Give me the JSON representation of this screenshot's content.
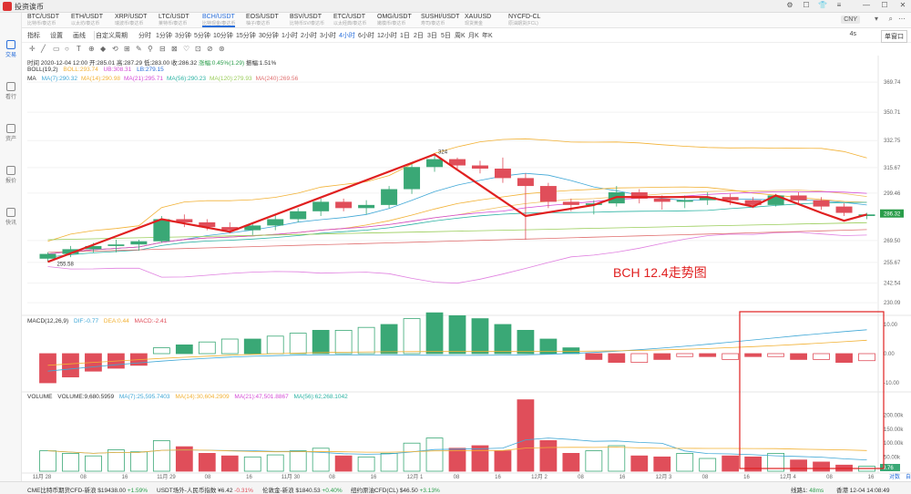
{
  "app": {
    "title": "投资诶币"
  },
  "nav": [
    {
      "label": "交易",
      "icon": "chart-icon",
      "active": true
    },
    {
      "label": "看行",
      "icon": "list-icon"
    },
    {
      "label": "资产",
      "icon": "wallet-icon"
    },
    {
      "label": "报价",
      "icon": "quote-icon"
    },
    {
      "label": "快讯",
      "icon": "news-icon"
    }
  ],
  "tabs": [
    {
      "symbol": "BTC/USDT",
      "sub": "比特币/泰达币"
    },
    {
      "symbol": "ETH/USDT",
      "sub": "以太坊/泰达币"
    },
    {
      "symbol": "XRP/USDT",
      "sub": "瑞波币/泰达币"
    },
    {
      "symbol": "LTC/USDT",
      "sub": "莱特币/泰达币"
    },
    {
      "symbol": "BCH/USDT",
      "sub": "比特现金/泰达币",
      "active": true
    },
    {
      "symbol": "EOS/USDT",
      "sub": "柚子/泰达币"
    },
    {
      "symbol": "BSV/USDT",
      "sub": "比特币SV/泰达币"
    },
    {
      "symbol": "ETC/USDT",
      "sub": "以太经典/泰达币"
    },
    {
      "symbol": "OMG/USDT",
      "sub": "嫩模币/泰达币"
    },
    {
      "symbol": "SUSHI/USDT",
      "sub": "寿司/泰达币"
    },
    {
      "symbol": "XAUUSD",
      "sub": "现货黄金"
    },
    {
      "symbol": "NYCFD-CL",
      "sub": "原油期货(FCL)"
    }
  ],
  "account": "CNY",
  "toolbar": {
    "items": [
      "指标",
      "设置",
      "画线",
      "自定义周期",
      "分时",
      "1分钟",
      "3分钟",
      "5分钟",
      "10分钟",
      "15分钟",
      "30分钟",
      "1小时",
      "2小时",
      "3小时",
      "4小时",
      "6小时",
      "12小时",
      "1日",
      "2日",
      "3日",
      "5日",
      "周K",
      "月K",
      "年K"
    ],
    "active": "4小时",
    "right_label": "4s",
    "single": "单窗口"
  },
  "ohlc": {
    "time": "时间 2020-12-04 12:00",
    "open": "开:285.01",
    "high": "高:287.29",
    "low": "低:283.00",
    "close": "收:286.32",
    "change": "涨幅:0.45%(1.29)",
    "amp": "振幅:1.51%"
  },
  "boll": {
    "label": "BOLL(19,2)",
    "boll": "BOLL:293.74",
    "ub": "UB:308.31",
    "lb": "LB:279.15"
  },
  "ma": {
    "label": "MA",
    "items": [
      {
        "text": "MA(7):290.32",
        "color": "#3fa7d6"
      },
      {
        "text": "MA(14):290.98",
        "color": "#f2b134"
      },
      {
        "text": "MA(21):295.71",
        "color": "#d44bd6"
      },
      {
        "text": "MA(56):290.23",
        "color": "#2bb3a3"
      },
      {
        "text": "MA(120):279.93",
        "color": "#9acd5a"
      },
      {
        "text": "MA(240):269.56",
        "color": "#e07070"
      }
    ]
  },
  "macd": {
    "label": "MACD(12,26,9)",
    "dif": "DIF:-0.77",
    "dea": "DEA:0.44",
    "macd": "MACD:-2.41",
    "ticks": [
      "10.00",
      "0.00",
      "-10.00"
    ]
  },
  "volume": {
    "label": "VOLUME",
    "vol": "VOLUME:9,680.5959",
    "ma7": "MA(7):25,595.7403",
    "ma14": "MA(14):30,604.2909",
    "ma21": "MA(21):47,501.8867",
    "ma56": "MA(56):62,268.1042",
    "ticks": [
      "200.00k",
      "150.00k",
      "100.00k",
      "50.00k"
    ],
    "last": "9.76"
  },
  "price_axis": [
    "369.74",
    "350.71",
    "332.75",
    "315.67",
    "299.46",
    "286.32",
    "269.50",
    "255.67",
    "242.54",
    "230.09"
  ],
  "time_axis": [
    "11月 28",
    "08",
    "16",
    "11月 29",
    "08",
    "16",
    "11月 30",
    "08",
    "16",
    "12月 1",
    "08",
    "16",
    "12月 2",
    "08",
    "16",
    "12月 3",
    "08",
    "16",
    "12月 4",
    "08",
    "16"
  ],
  "labels": {
    "high_mark": "324",
    "low_mark": "255.58",
    "annotation": "BCH 12.4走势图"
  },
  "footer_right": {
    "reset": "对数",
    "auto": "自动"
  },
  "chart_data": {
    "type": "candlestick",
    "interval": "4小时",
    "candles": [
      {
        "o": 258,
        "h": 262,
        "l": 256,
        "c": 261
      },
      {
        "o": 261,
        "h": 266,
        "l": 259,
        "c": 264
      },
      {
        "o": 264,
        "h": 268,
        "l": 262,
        "c": 266
      },
      {
        "o": 266,
        "h": 270,
        "l": 262,
        "c": 267
      },
      {
        "o": 267,
        "h": 270,
        "l": 263,
        "c": 269
      },
      {
        "o": 269,
        "h": 285,
        "l": 268,
        "c": 283
      },
      {
        "o": 283,
        "h": 286,
        "l": 278,
        "c": 281
      },
      {
        "o": 281,
        "h": 283,
        "l": 276,
        "c": 278
      },
      {
        "o": 278,
        "h": 281,
        "l": 274,
        "c": 276
      },
      {
        "o": 276,
        "h": 281,
        "l": 273,
        "c": 279
      },
      {
        "o": 279,
        "h": 286,
        "l": 276,
        "c": 283
      },
      {
        "o": 283,
        "h": 290,
        "l": 281,
        "c": 288
      },
      {
        "o": 288,
        "h": 296,
        "l": 285,
        "c": 294
      },
      {
        "o": 294,
        "h": 296,
        "l": 288,
        "c": 290
      },
      {
        "o": 290,
        "h": 295,
        "l": 286,
        "c": 292
      },
      {
        "o": 292,
        "h": 304,
        "l": 290,
        "c": 302
      },
      {
        "o": 302,
        "h": 318,
        "l": 299,
        "c": 316
      },
      {
        "o": 316,
        "h": 324,
        "l": 313,
        "c": 321
      },
      {
        "o": 321,
        "h": 322,
        "l": 315,
        "c": 317
      },
      {
        "o": 317,
        "h": 320,
        "l": 312,
        "c": 315
      },
      {
        "o": 315,
        "h": 322,
        "l": 306,
        "c": 309
      },
      {
        "o": 309,
        "h": 312,
        "l": 270,
        "c": 304
      },
      {
        "o": 304,
        "h": 306,
        "l": 290,
        "c": 294
      },
      {
        "o": 294,
        "h": 296,
        "l": 288,
        "c": 292
      },
      {
        "o": 292,
        "h": 295,
        "l": 286,
        "c": 293
      },
      {
        "o": 293,
        "h": 304,
        "l": 291,
        "c": 300
      },
      {
        "o": 300,
        "h": 302,
        "l": 293,
        "c": 296
      },
      {
        "o": 296,
        "h": 298,
        "l": 289,
        "c": 294
      },
      {
        "o": 294,
        "h": 298,
        "l": 290,
        "c": 295
      },
      {
        "o": 295,
        "h": 300,
        "l": 292,
        "c": 297
      },
      {
        "o": 297,
        "h": 299,
        "l": 292,
        "c": 295
      },
      {
        "o": 295,
        "h": 297,
        "l": 290,
        "c": 292
      },
      {
        "o": 292,
        "h": 299,
        "l": 291,
        "c": 298
      },
      {
        "o": 298,
        "h": 300,
        "l": 293,
        "c": 295
      },
      {
        "o": 295,
        "h": 297,
        "l": 289,
        "c": 291
      },
      {
        "o": 291,
        "h": 293,
        "l": 285,
        "c": 287
      },
      {
        "o": 285,
        "h": 287,
        "l": 283,
        "c": 286
      }
    ],
    "volume": [
      40,
      35,
      30,
      42,
      38,
      60,
      48,
      35,
      30,
      28,
      32,
      40,
      45,
      30,
      28,
      35,
      55,
      65,
      45,
      50,
      40,
      140,
      60,
      35,
      40,
      50,
      30,
      28,
      35,
      25,
      30,
      28,
      35,
      22,
      18,
      12,
      9.68
    ],
    "macd_hist": [
      -10,
      -8,
      -6,
      -5,
      -4,
      2,
      3,
      4,
      5,
      5,
      6,
      7,
      8,
      8,
      9,
      10,
      12,
      14,
      13,
      12,
      10,
      8,
      5,
      2,
      -2,
      -3,
      -3,
      -2,
      -1,
      -1,
      -2,
      -1,
      -1,
      -2,
      -2,
      -3,
      -2.41
    ],
    "price_range": [
      225,
      375
    ]
  }
}
